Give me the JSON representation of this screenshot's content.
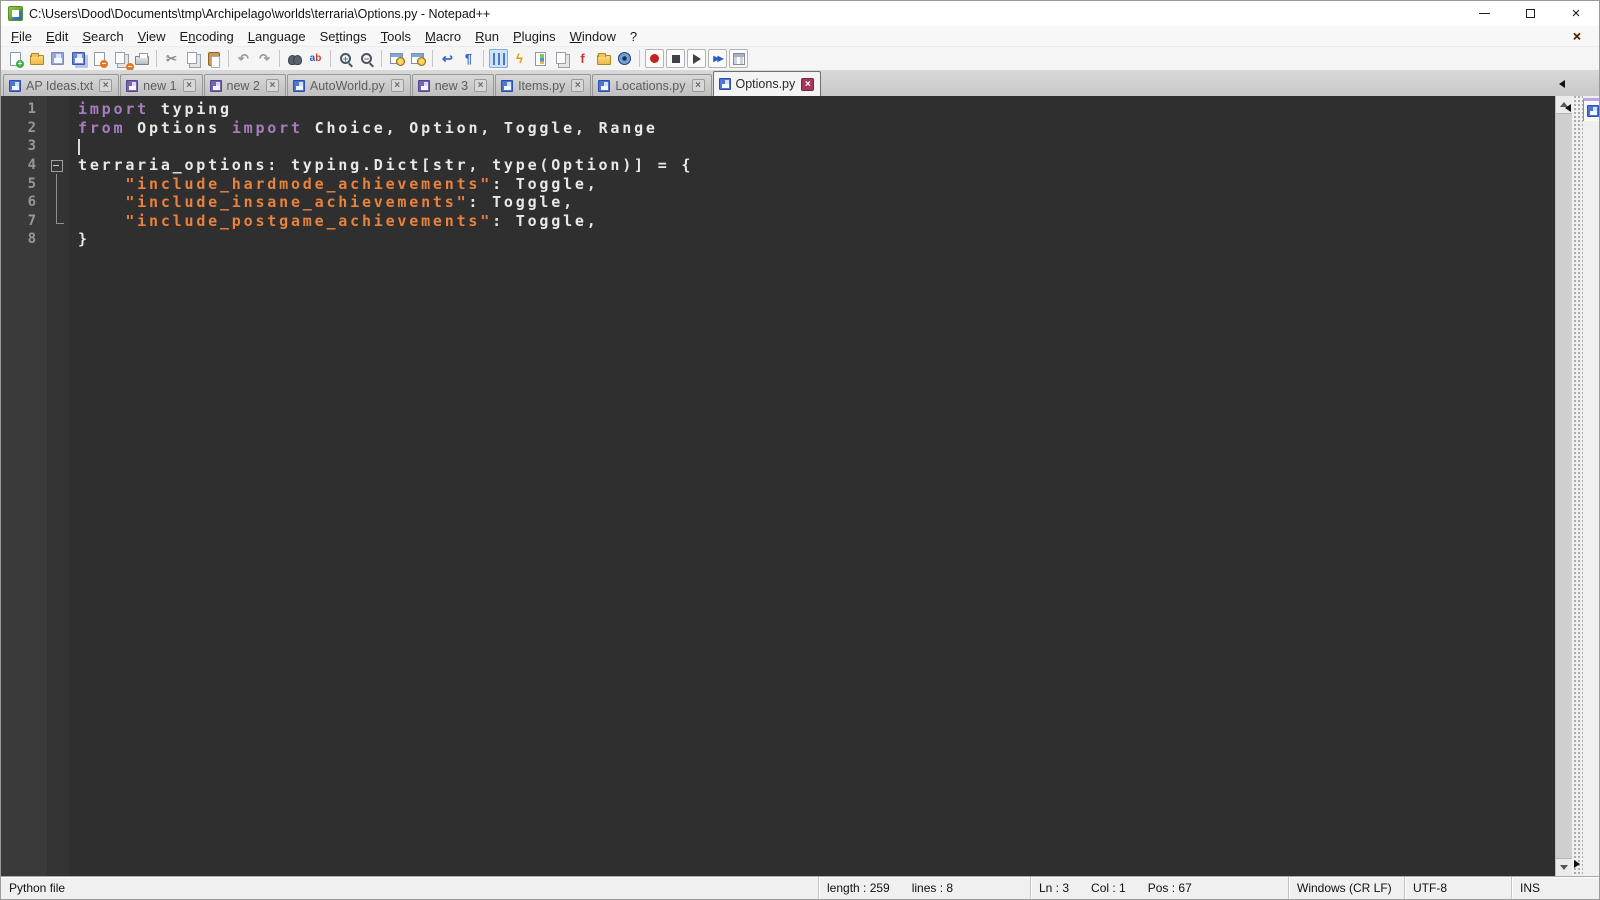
{
  "window": {
    "title": "C:\\Users\\Dood\\Documents\\tmp\\Archipelago\\worlds\\terraria\\Options.py - Notepad++",
    "minimize_glyph": "minimize",
    "restore_glyph": "restore",
    "close_glyph": "×"
  },
  "menu": {
    "items": [
      {
        "label": "File",
        "u": 0
      },
      {
        "label": "Edit",
        "u": 0
      },
      {
        "label": "Search",
        "u": 0
      },
      {
        "label": "View",
        "u": 0
      },
      {
        "label": "Encoding",
        "u": 1
      },
      {
        "label": "Language",
        "u": 0
      },
      {
        "label": "Settings",
        "u": 2
      },
      {
        "label": "Tools",
        "u": 0
      },
      {
        "label": "Macro",
        "u": 0
      },
      {
        "label": "Run",
        "u": 0
      },
      {
        "label": "Plugins",
        "u": 0
      },
      {
        "label": "Window",
        "u": 0
      },
      {
        "label": "?",
        "u": -1
      }
    ],
    "close_document_glyph": "×"
  },
  "toolbar": {
    "groups": [
      [
        {
          "name": "new-file-button",
          "kind": "new"
        },
        {
          "name": "open-file-button",
          "kind": "open"
        },
        {
          "name": "save-button",
          "kind": "save"
        },
        {
          "name": "save-all-button",
          "kind": "saveall"
        },
        {
          "name": "close-file-button",
          "kind": "closefile"
        },
        {
          "name": "close-all-button",
          "kind": "closeall"
        },
        {
          "name": "print-button",
          "kind": "print"
        }
      ],
      [
        {
          "name": "cut-button",
          "kind": "glyph",
          "glyph": "✂",
          "color": "#8a8a8a"
        },
        {
          "name": "copy-button",
          "kind": "copy"
        },
        {
          "name": "paste-button",
          "kind": "paste"
        }
      ],
      [
        {
          "name": "undo-button",
          "kind": "glyph",
          "glyph": "↶",
          "color": "#9a9a9a"
        },
        {
          "name": "redo-button",
          "kind": "glyph",
          "glyph": "↷",
          "color": "#9a9a9a"
        }
      ],
      [
        {
          "name": "find-button",
          "kind": "find"
        },
        {
          "name": "replace-button",
          "kind": "replace"
        }
      ],
      [
        {
          "name": "zoom-in-button",
          "kind": "zoomin"
        },
        {
          "name": "zoom-out-button",
          "kind": "zoomout"
        }
      ],
      [
        {
          "name": "sync-vertical-scroll-button",
          "kind": "sync"
        },
        {
          "name": "sync-horizontal-scroll-button",
          "kind": "sync"
        }
      ],
      [
        {
          "name": "word-wrap-button",
          "kind": "glyph",
          "glyph": "↩",
          "color": "#3565c6"
        },
        {
          "name": "show-all-characters-button",
          "kind": "glyph",
          "glyph": "¶",
          "color": "#3565c6"
        }
      ],
      [
        {
          "name": "show-indent-guide-button",
          "kind": "indent",
          "pressed": true
        },
        {
          "name": "function-completion-button",
          "kind": "glyph",
          "glyph": "ϟ",
          "color": "#e09a10"
        },
        {
          "name": "document-map-button",
          "kind": "map"
        },
        {
          "name": "document-list-button",
          "kind": "copy"
        },
        {
          "name": "function-list-button",
          "kind": "glyph",
          "glyph": "f",
          "color": "#c43a3a"
        },
        {
          "name": "folder-as-workspace-button",
          "kind": "open"
        },
        {
          "name": "monitoring-button",
          "kind": "eye"
        }
      ],
      [
        {
          "name": "macro-record-button",
          "kind": "rec",
          "boxed": true
        },
        {
          "name": "macro-stop-button",
          "kind": "stop",
          "boxed": true
        },
        {
          "name": "macro-play-button",
          "kind": "play",
          "boxed": true
        },
        {
          "name": "macro-run-multiple-button",
          "kind": "play2",
          "boxed": true
        },
        {
          "name": "macro-save-button",
          "kind": "grid",
          "boxed": true
        }
      ]
    ]
  },
  "tabs": {
    "items": [
      {
        "label": "AP Ideas.txt",
        "icon": "blue",
        "active": false
      },
      {
        "label": "new 1",
        "icon": "purple",
        "active": false
      },
      {
        "label": "new 2",
        "icon": "purple",
        "active": false
      },
      {
        "label": "AutoWorld.py",
        "icon": "blue",
        "active": false
      },
      {
        "label": "new 3",
        "icon": "purple",
        "active": false
      },
      {
        "label": "Items.py",
        "icon": "blue",
        "active": false
      },
      {
        "label": "Locations.py",
        "icon": "blue",
        "active": false
      },
      {
        "label": "Options.py",
        "icon": "blue",
        "active": true
      }
    ],
    "close_glyph": "×"
  },
  "editor": {
    "colors": {
      "background": "#2f2f2f",
      "keyword": "#a87cc0",
      "string": "#e8823c",
      "text": "#e8e8e8",
      "line_number": "#979797"
    },
    "lines": [
      {
        "num": 1,
        "fold": "",
        "tokens": [
          {
            "k": "k",
            "s": "import"
          },
          {
            "k": "t",
            "s": " typing"
          }
        ]
      },
      {
        "num": 2,
        "fold": "",
        "tokens": [
          {
            "k": "k",
            "s": "from"
          },
          {
            "k": "t",
            "s": " Options "
          },
          {
            "k": "k",
            "s": "import"
          },
          {
            "k": "t",
            "s": " Choice, Option, Toggle, Range"
          }
        ]
      },
      {
        "num": 3,
        "fold": "",
        "caret": true,
        "tokens": []
      },
      {
        "num": 4,
        "fold": "box",
        "tokens": [
          {
            "k": "t",
            "s": "terraria_options: typing.Dict[str, type(Option)] = {"
          }
        ]
      },
      {
        "num": 5,
        "fold": "v",
        "tokens": [
          {
            "k": "t",
            "s": "    "
          },
          {
            "k": "s",
            "s": "\"include_hardmode_achievements\""
          },
          {
            "k": "t",
            "s": ": Toggle,"
          }
        ]
      },
      {
        "num": 6,
        "fold": "v",
        "tokens": [
          {
            "k": "t",
            "s": "    "
          },
          {
            "k": "s",
            "s": "\"include_insane_achievements\""
          },
          {
            "k": "t",
            "s": ": Toggle,"
          }
        ]
      },
      {
        "num": 7,
        "fold": "corner",
        "tokens": [
          {
            "k": "t",
            "s": "    "
          },
          {
            "k": "s",
            "s": "\"include_postgame_achievements\""
          },
          {
            "k": "t",
            "s": ": Toggle,"
          }
        ]
      },
      {
        "num": 8,
        "fold": "",
        "tokens": [
          {
            "k": "t",
            "s": "}"
          }
        ]
      }
    ]
  },
  "statusbar": {
    "doc_type": "Python file",
    "length_label": "length : 259",
    "lines_label": "lines : 8",
    "ln_label": "Ln : 3",
    "col_label": "Col : 1",
    "pos_label": "Pos : 67",
    "eol": "Windows (CR LF)",
    "encoding": "UTF-8",
    "mode": "INS"
  }
}
